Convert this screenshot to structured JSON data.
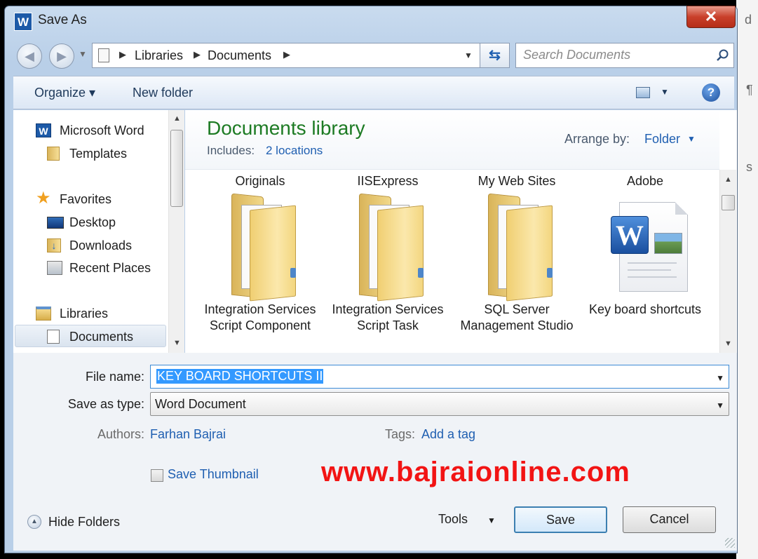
{
  "window": {
    "title": "Save As",
    "app_badge": "W",
    "close_symbol": "✕"
  },
  "background": {
    "ghost_text": "d",
    "ghost_text2": "¶",
    "ghost_text3": "s"
  },
  "nav": {
    "back_symbol": "◀",
    "forward_symbol": "▶",
    "address": [
      "Libraries",
      "Documents"
    ],
    "search_placeholder": "Search Documents"
  },
  "toolbar": {
    "organize": "Organize ▾",
    "new_folder": "New folder",
    "help": "?"
  },
  "sidebar": {
    "items": [
      {
        "label": "Microsoft Word",
        "icon": "word-icon"
      },
      {
        "label": "Templates",
        "icon": "folder-icon"
      },
      {
        "label": "Favorites",
        "icon": "star-icon"
      },
      {
        "label": "Desktop",
        "icon": "desktop-icon"
      },
      {
        "label": "Downloads",
        "icon": "downloads-icon"
      },
      {
        "label": "Recent Places",
        "icon": "recent-places-icon"
      },
      {
        "label": "Libraries",
        "icon": "libraries-icon"
      },
      {
        "label": "Documents",
        "icon": "document-icon"
      }
    ]
  },
  "library": {
    "title": "Documents library",
    "includes_label": "Includes:",
    "locations_link": "2 locations",
    "arrange_label": "Arrange by:",
    "arrange_value": "Folder"
  },
  "files": {
    "top_row": [
      "Originals",
      "IISExpress",
      "My Web Sites",
      "Adobe"
    ],
    "items": [
      {
        "name": "Integration Services Script Component",
        "type": "folder"
      },
      {
        "name": "Integration Services Script Task",
        "type": "folder"
      },
      {
        "name": "SQL Server Management Studio",
        "type": "folder"
      },
      {
        "name": "Key board shortcuts",
        "type": "word-document"
      }
    ]
  },
  "form": {
    "file_name_label": "File name:",
    "file_name_value": "KEY BOARD SHORTCUTS II",
    "save_type_label": "Save as type:",
    "save_type_value": "Word Document",
    "authors_label": "Authors:",
    "authors_value": "Farhan Bajrai",
    "tags_label": "Tags:",
    "tags_value": "Add a tag",
    "save_thumbnail_label": "Save Thumbnail",
    "save_thumbnail_checked": false
  },
  "watermark": "www.bajraionline.com",
  "footer": {
    "hide_folders": "Hide Folders",
    "tools": "Tools",
    "save": "Save",
    "cancel": "Cancel"
  },
  "colors": {
    "accent": "#1f5fb1",
    "library_title": "#1d7b24",
    "watermark": "#f21414",
    "selection": "#3399ff"
  }
}
